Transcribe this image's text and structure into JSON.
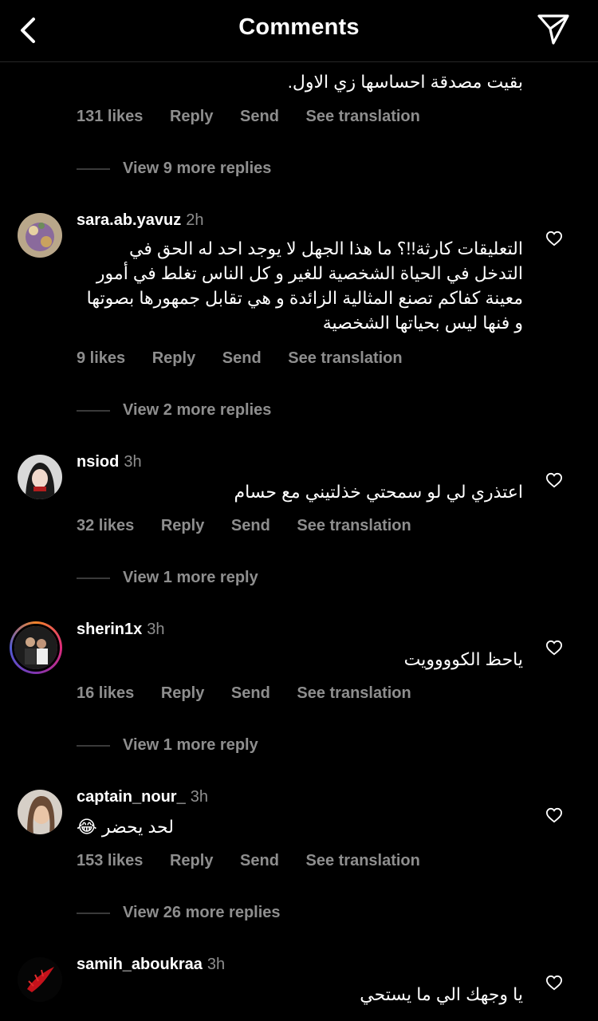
{
  "header": {
    "title": "Comments"
  },
  "top_comment": {
    "text_cut": "بقيت مصدقة احساسها زي الاول.",
    "likes": "131 likes",
    "reply": "Reply",
    "send": "Send",
    "translation": "See translation",
    "view_more": "View 9 more replies"
  },
  "comments": [
    {
      "username": "sara.ab.yavuz",
      "time": "2h",
      "text": "التعليقات كارثة!!؟ ما هذا الجهل لا يوجد احد له الحق في التدخل في الحياة الشخصية للغير و كل الناس تغلط في أمور معينة كفاكم تصنع المثالية الزائدة و هي تقابل جمهورها بصوتها و فنها ليس بحياتها الشخصية",
      "likes": "9 likes",
      "reply": "Reply",
      "send": "Send",
      "translation": "See translation",
      "view_more": "View 2 more replies"
    },
    {
      "username": "nsiod",
      "time": "3h",
      "text": "اعتذري لي لو سمحتي خذلتيني مع حسام",
      "likes": "32 likes",
      "reply": "Reply",
      "send": "Send",
      "translation": "See translation",
      "view_more": "View 1 more reply"
    },
    {
      "username": "sherin1x",
      "time": "3h",
      "text": "ياحظ الكوووويت",
      "likes": "16 likes",
      "reply": "Reply",
      "send": "Send",
      "translation": "See translation",
      "view_more": "View 1 more reply"
    },
    {
      "username": "captain_nour_",
      "time": "3h",
      "text": "لحد يحضر 😂",
      "likes": "153 likes",
      "reply": "Reply",
      "send": "Send",
      "translation": "See translation",
      "view_more": "View 26 more replies"
    },
    {
      "username": "samih_aboukraa",
      "time": "3h",
      "text": "يا وجهك الي ما يستحي"
    }
  ],
  "icons": {
    "back": "chevron-left-icon",
    "share": "paper-plane-icon",
    "like": "heart-outline-icon"
  }
}
